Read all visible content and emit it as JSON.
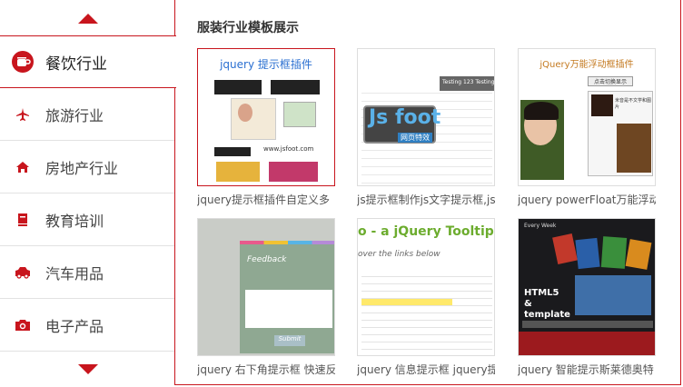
{
  "sidebar": {
    "items": [
      {
        "label": "餐饮行业"
      },
      {
        "label": "旅游行业"
      },
      {
        "label": "房地产行业"
      },
      {
        "label": "教育培训"
      },
      {
        "label": "汽车用品"
      },
      {
        "label": "电子产品"
      }
    ]
  },
  "panel": {
    "title": "服装行业模板展示",
    "cards": [
      {
        "caption": "jquery提示框插件自定义多",
        "thumb_text": "jquery 提示框插件",
        "thumb_sub": "www.jsfoot.com"
      },
      {
        "caption": "js提示框制作js文字提示框,js",
        "thumb_text": "Js foot",
        "thumb_sub": "网页特效",
        "thumb_extra": "Testing 123 Testing"
      },
      {
        "caption": "jquery powerFloat万能浮动",
        "thumb_text": "jQuery万能浮动框插件",
        "thumb_sub": "点击切换显示",
        "thumb_extra": "米音是不文学和图片"
      },
      {
        "caption": "jquery 右下角提示框 快速反",
        "thumb_text": "Feedback",
        "thumb_sub": "Submit"
      },
      {
        "caption": "jquery 信息提示框 jquery提",
        "thumb_text": "o - a jQuery Tooltip Pl",
        "thumb_sub": "over the links below"
      },
      {
        "caption": "jquery 智能提示斯莱德奥特",
        "thumb_text": "HTML5 & template",
        "thumb_sub": "Every Week"
      }
    ]
  },
  "colors": {
    "accent": "#c8151d"
  }
}
